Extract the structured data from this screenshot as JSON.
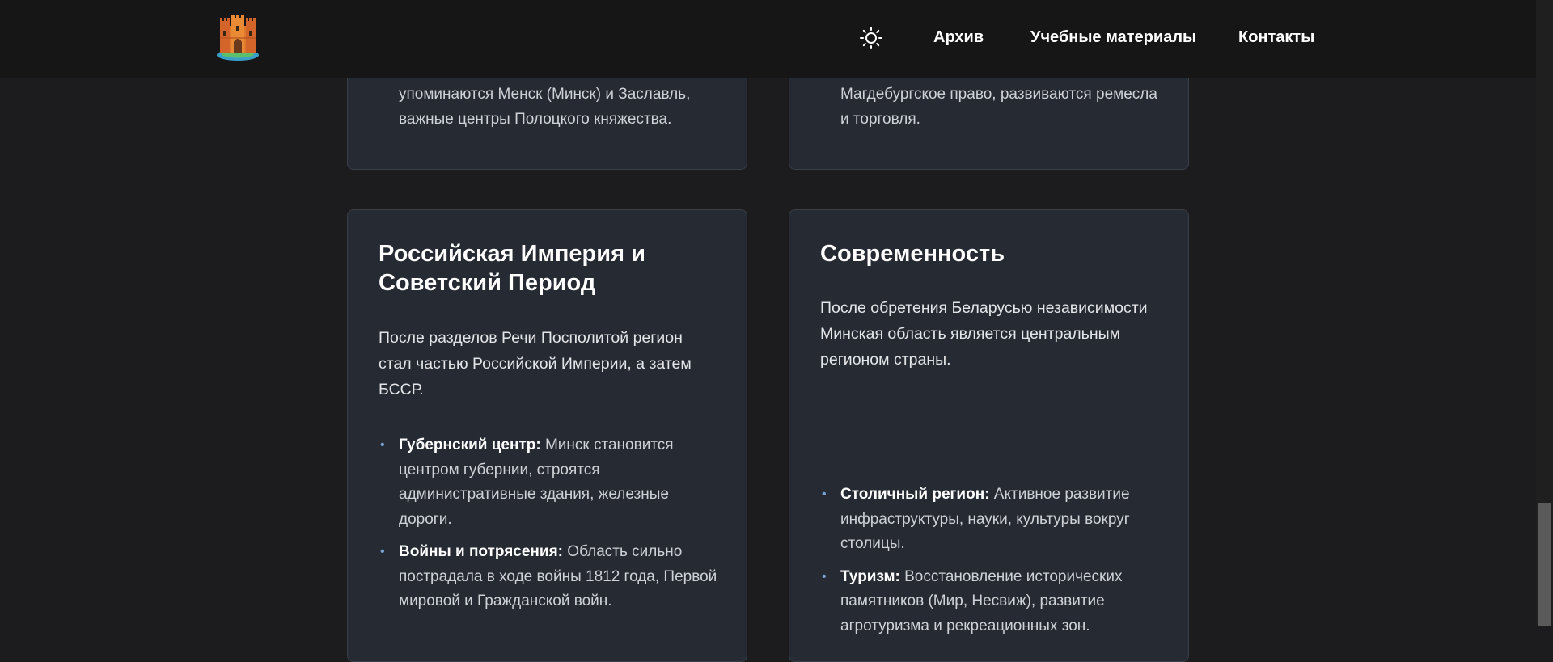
{
  "header": {
    "logo_alt": "castle logo",
    "nav": [
      "Архив",
      "Учебные материалы",
      "Контакты"
    ]
  },
  "cards": {
    "top_left": {
      "text": "упоминаются Менск (Минск) и Заславль, важные центры Полоцкого княжества."
    },
    "top_right": {
      "text": "Магдебургское право, развиваются ремесла и торговля."
    },
    "empire": {
      "title": "Российская Империя и Советский Период",
      "intro": "После разделов Речи Посполитой регион стал частью Российской Империи, а затем БССР.",
      "bullets": [
        {
          "term": "Губернский центр:",
          "text": " Минск становится центром губернии, строятся административные здания, железные дороги."
        },
        {
          "term": "Войны и потрясения:",
          "text": " Область сильно пострадала в ходе войны 1812 года, Первой мировой и Гражданской войн."
        }
      ]
    },
    "modern": {
      "title": "Современность",
      "intro": "После обретения Беларусью независимости Минская область является центральным регионом страны.",
      "bullets": [
        {
          "term": "Столичный регион:",
          "text": " Активное развитие инфраструктуры, науки, культуры вокруг столицы."
        },
        {
          "term": "Туризм:",
          "text": " Восстановление исторических памятников (Мир, Несвиж), развитие агротуризма и рекреационных зон."
        }
      ]
    }
  },
  "colors": {
    "header_bg": "#161616",
    "page_bg": "#1c1c1e",
    "card_bg": "#262a33",
    "bullet": "#7aa4d6"
  }
}
